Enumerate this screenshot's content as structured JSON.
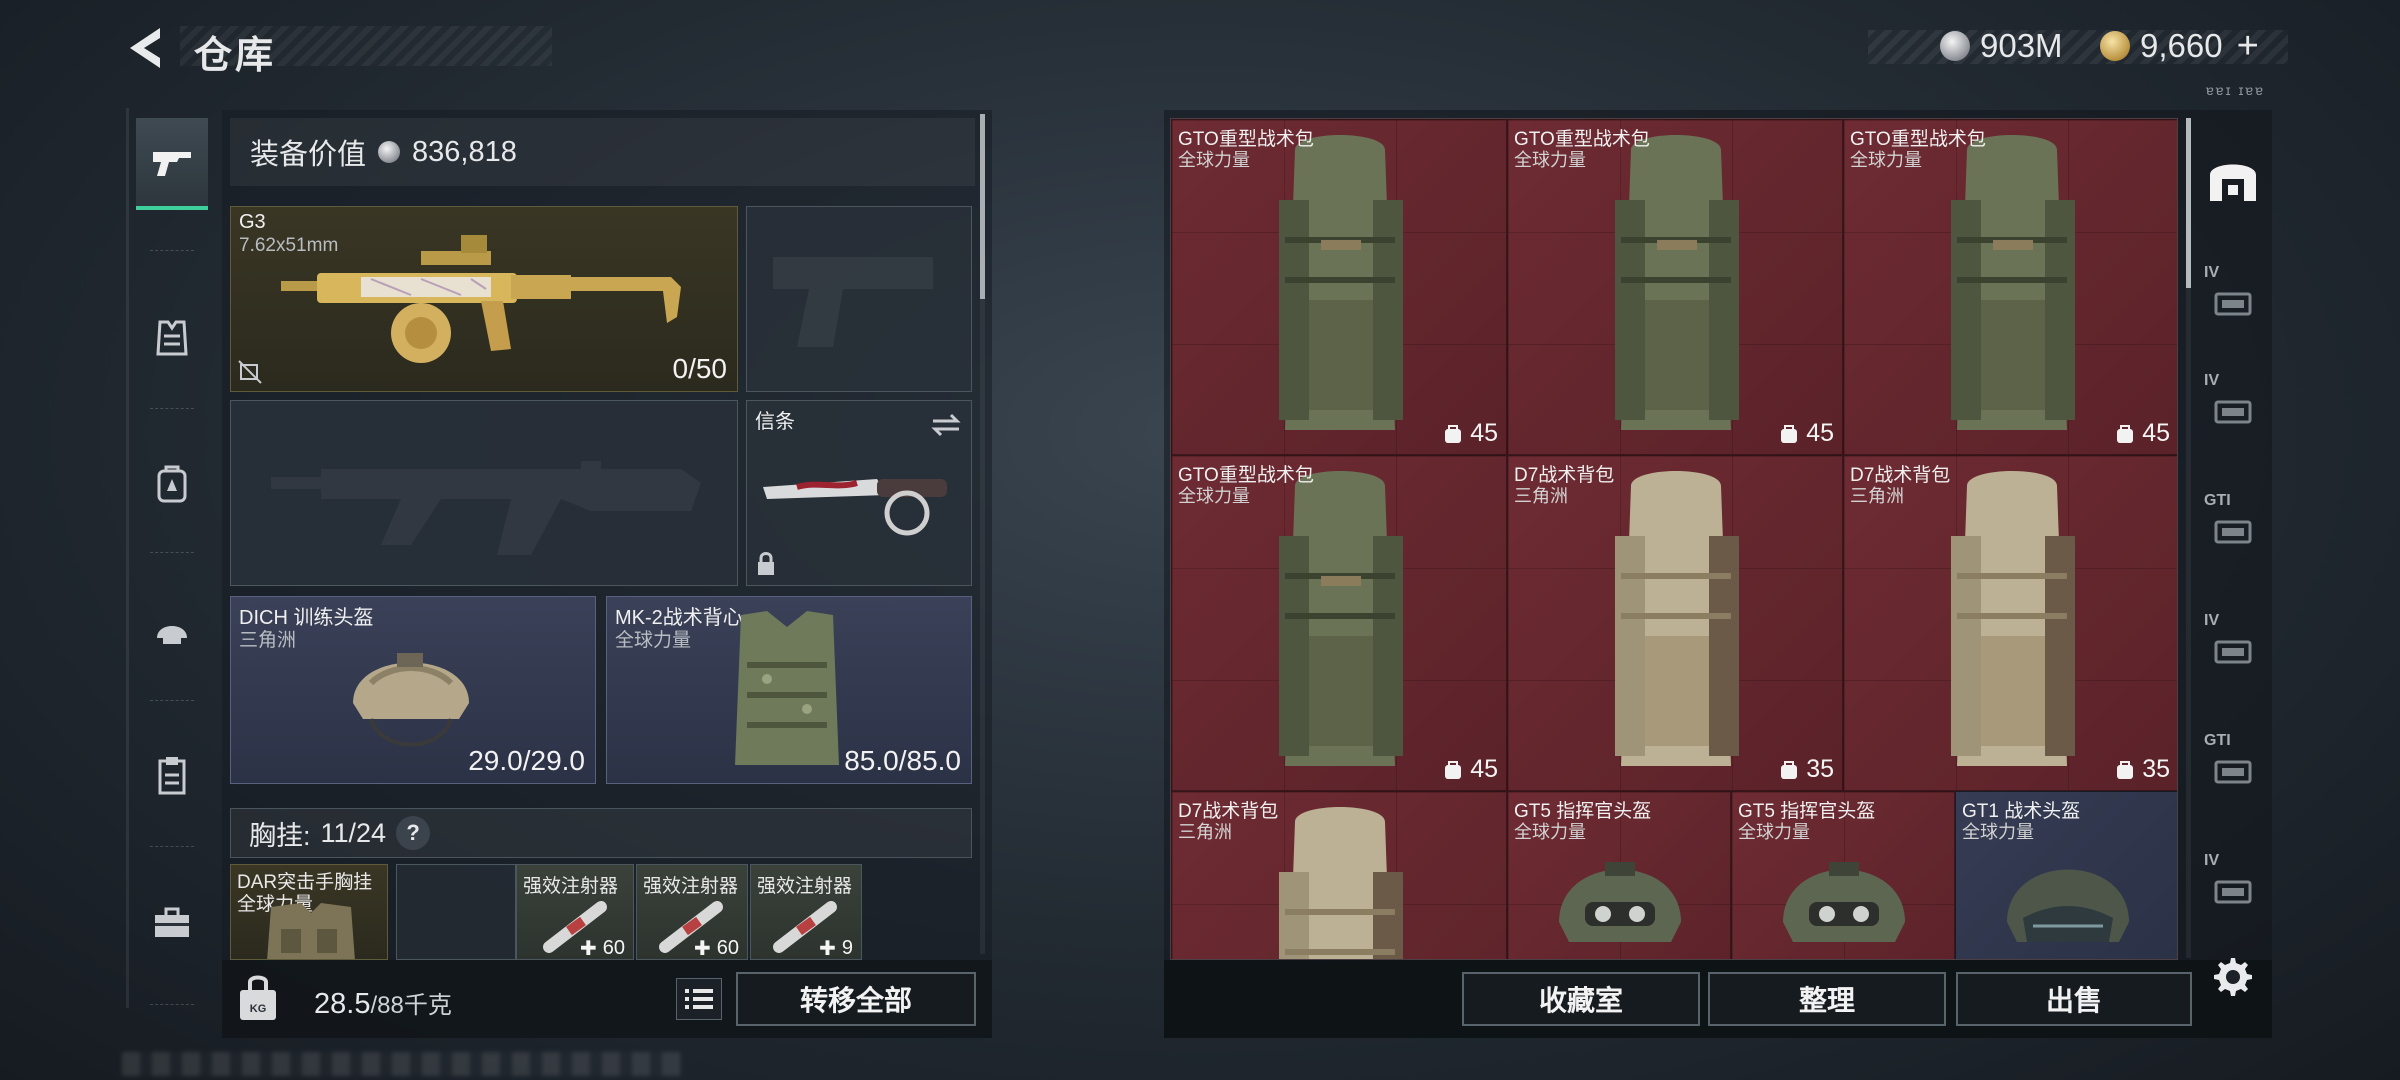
{
  "header": {
    "title": "仓库",
    "currency_silver": "903M",
    "currency_gold": "9,660",
    "plus_label": "+",
    "small_label": "ɐɐɪ ɪɐɐ"
  },
  "nav": {
    "items": [
      "weapons-icon",
      "vest-icon",
      "backpack-icon",
      "helmet-icon",
      "clipboard-icon",
      "toolbox-icon"
    ],
    "active": "weapons-icon"
  },
  "loadout": {
    "value_label": "装备价值",
    "value": "836,818",
    "primary": {
      "name": "G3",
      "caliber": "7.62x51mm",
      "ammo": "0/50"
    },
    "melee": {
      "name": "信条"
    },
    "helmet": {
      "name": "DICH 训练头盔",
      "faction": "三角洲",
      "durability": "29.0/29.0"
    },
    "armor": {
      "name": "MK-2战术背心",
      "faction": "全球力量",
      "durability": "85.0/85.0"
    },
    "chest_rig": {
      "label": "胸挂:",
      "capacity": "11/24",
      "help": "?"
    },
    "rig_item": {
      "name": "DAR突击手胸挂",
      "faction": "全球力量"
    },
    "injectors": [
      {
        "name": "强效注射器",
        "count": "60"
      },
      {
        "name": "强效注射器",
        "count": "60"
      },
      {
        "name": "强效注射器",
        "count": "9"
      }
    ],
    "weight": "28.5",
    "weight_max": "/88千克",
    "transfer_button": "转移全部"
  },
  "inventory": {
    "cells": [
      {
        "name": "GTO重型战术包",
        "faction": "全球力量",
        "count": "45",
        "color": "red",
        "art": "pack-green"
      },
      {
        "name": "GTO重型战术包",
        "faction": "全球力量",
        "count": "45",
        "color": "red",
        "art": "pack-green"
      },
      {
        "name": "GTO重型战术包",
        "faction": "全球力量",
        "count": "45",
        "color": "red",
        "art": "pack-green"
      },
      {
        "name": "GTO重型战术包",
        "faction": "全球力量",
        "count": "45",
        "color": "red",
        "art": "pack-green"
      },
      {
        "name": "D7战术背包",
        "faction": "三角洲",
        "count": "35",
        "color": "red",
        "art": "pack-tan"
      },
      {
        "name": "D7战术背包",
        "faction": "三角洲",
        "count": "35",
        "color": "red",
        "art": "pack-tan"
      },
      {
        "name": "D7战术背包",
        "faction": "三角洲",
        "count": "",
        "color": "red",
        "art": "pack-tan"
      },
      {
        "name": "GT5 指挥官头盔",
        "faction": "全球力量",
        "count": "",
        "color": "red",
        "art": "helmet-nvg"
      },
      {
        "name": "GT5 指挥官头盔",
        "faction": "全球力量",
        "count": "",
        "color": "red",
        "art": "helmet-nvg"
      },
      {
        "name": "GT1 战术头盔",
        "faction": "全球力量",
        "count": "",
        "color": "blue",
        "art": "helmet-goggles"
      }
    ],
    "buttons": {
      "collection": "收藏室",
      "sort": "整理",
      "sell": "出售"
    }
  },
  "categories": {
    "items": [
      {
        "icon": "safehouse-icon",
        "tier": ""
      },
      {
        "icon": "folder-icon",
        "tier": "IV"
      },
      {
        "icon": "medkit-plus-icon",
        "tier": "IV"
      },
      {
        "icon": "equipment-icon",
        "tier": "GTI"
      },
      {
        "icon": "rifle-case-icon",
        "tier": "IV"
      },
      {
        "icon": "hand-icon",
        "tier": "GTI"
      },
      {
        "icon": "truck-icon",
        "tier": "IV"
      }
    ],
    "settings": "gear-icon"
  },
  "colors": {
    "accent_green": "#3fcf9c",
    "cell_red": "#6e2b33",
    "cell_blue": "#353c54",
    "slot_blue": "#3a4158"
  }
}
